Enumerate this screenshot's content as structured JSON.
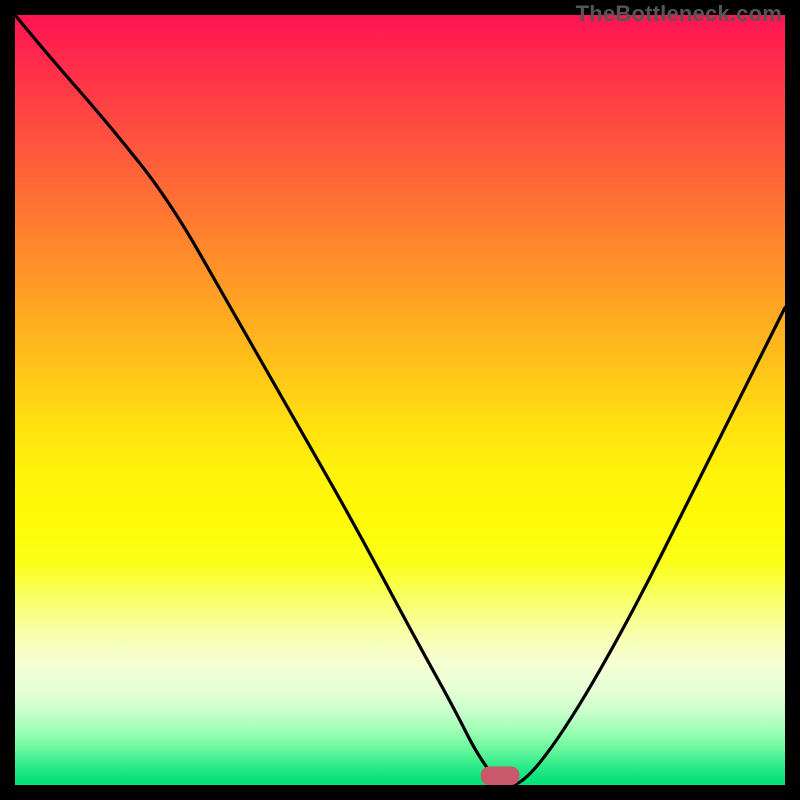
{
  "watermark": "TheBottleneck.com",
  "chart_data": {
    "type": "line",
    "title": "",
    "xlabel": "",
    "ylabel": "",
    "xlim": [
      0,
      100
    ],
    "ylim": [
      0,
      100
    ],
    "note": "Bottleneck-style V-curve over heatmap gradient (green = good, red = bad). Minimum at x≈63.",
    "series": [
      {
        "name": "bottleneck_curve",
        "x": [
          0,
          5,
          12,
          20,
          28,
          36,
          44,
          52,
          57,
          60,
          63,
          66,
          72,
          80,
          88,
          96,
          100
        ],
        "y": [
          100,
          94,
          86,
          76,
          62,
          48,
          34,
          19,
          10,
          4,
          0,
          0,
          8,
          22,
          38,
          54,
          62
        ]
      }
    ],
    "marker": {
      "x": 63,
      "y": 0,
      "width_x": 5,
      "height_y": 2.4,
      "color": "#c9586a"
    },
    "gradient_stops": [
      {
        "pos": 0,
        "color": "#ff1452"
      },
      {
        "pos": 30,
        "color": "#ff872d"
      },
      {
        "pos": 54,
        "color": "#ffe30f"
      },
      {
        "pos": 80,
        "color": "#f7ffa8"
      },
      {
        "pos": 93,
        "color": "#9cffb4"
      },
      {
        "pos": 100,
        "color": "#04e076"
      }
    ]
  }
}
